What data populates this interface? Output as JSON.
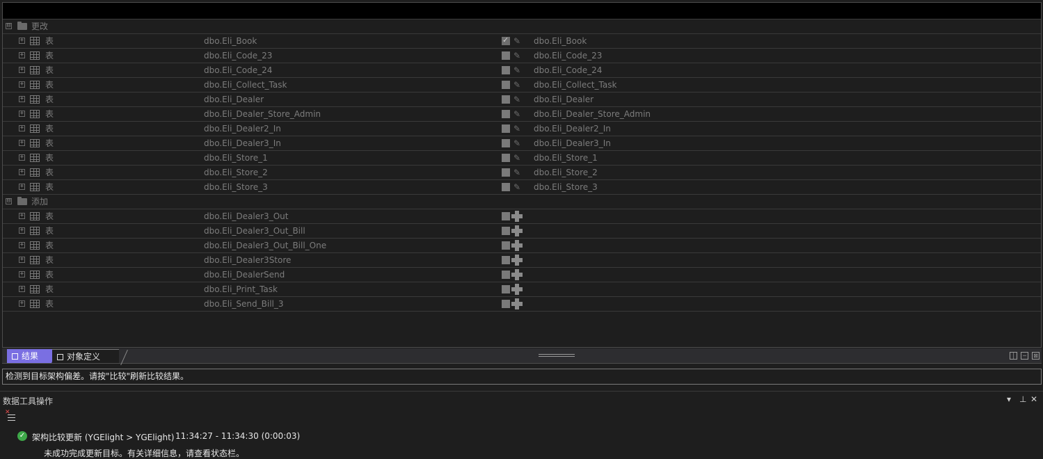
{
  "grid": {
    "groups": [
      {
        "label": "更改",
        "expander": "⊟",
        "rows": [
          {
            "type": "表",
            "source": "dbo.Eli_Book",
            "target": "dbo.Eli_Book",
            "checked": true
          },
          {
            "type": "表",
            "source": "dbo.Eli_Code_23",
            "target": "dbo.Eli_Code_23",
            "checked": false
          },
          {
            "type": "表",
            "source": "dbo.Eli_Code_24",
            "target": "dbo.Eli_Code_24",
            "checked": false
          },
          {
            "type": "表",
            "source": "dbo.Eli_Collect_Task",
            "target": "dbo.Eli_Collect_Task",
            "checked": false
          },
          {
            "type": "表",
            "source": "dbo.Eli_Dealer",
            "target": "dbo.Eli_Dealer",
            "checked": false
          },
          {
            "type": "表",
            "source": "dbo.Eli_Dealer_Store_Admin",
            "target": "dbo.Eli_Dealer_Store_Admin",
            "checked": false
          },
          {
            "type": "表",
            "source": "dbo.Eli_Dealer2_In",
            "target": "dbo.Eli_Dealer2_In",
            "checked": false
          },
          {
            "type": "表",
            "source": "dbo.Eli_Dealer3_In",
            "target": "dbo.Eli_Dealer3_In",
            "checked": false
          },
          {
            "type": "表",
            "source": "dbo.Eli_Store_1",
            "target": "dbo.Eli_Store_1",
            "checked": false
          },
          {
            "type": "表",
            "source": "dbo.Eli_Store_2",
            "target": "dbo.Eli_Store_2",
            "checked": false
          },
          {
            "type": "表",
            "source": "dbo.Eli_Store_3",
            "target": "dbo.Eli_Store_3",
            "checked": false
          }
        ]
      },
      {
        "label": "添加",
        "expander": "⊟",
        "rows": [
          {
            "type": "表",
            "source": "dbo.Eli_Dealer3_Out",
            "target": "",
            "checked": false
          },
          {
            "type": "表",
            "source": "dbo.Eli_Dealer3_Out_Bill",
            "target": "",
            "checked": false
          },
          {
            "type": "表",
            "source": "dbo.Eli_Dealer3_Out_Bill_One",
            "target": "",
            "checked": false
          },
          {
            "type": "表",
            "source": "dbo.Eli_Dealer3Store",
            "target": "",
            "checked": false
          },
          {
            "type": "表",
            "source": "dbo.Eli_DealerSend",
            "target": "",
            "checked": false
          },
          {
            "type": "表",
            "source": "dbo.Eli_Print_Task",
            "target": "",
            "checked": false
          },
          {
            "type": "表",
            "source": "dbo.Eli_Send_Bill_3",
            "target": "",
            "checked": false
          }
        ]
      }
    ],
    "row_expander": "+",
    "icons": {
      "group": "folder-icon",
      "row": "table-icon",
      "change_action": "pencil-icon",
      "add_action": "plus-icon"
    }
  },
  "tabs": {
    "results": "结果",
    "object_definition": "对象定义"
  },
  "status_message": "检测到目标架构偏差。请按\"比较\"刷新比较结果。",
  "ops": {
    "title": "数据工具操作",
    "dropdown_glyph": "▾",
    "pin_glyph": "⊥",
    "close_glyph": "✕",
    "operation": {
      "title": "架构比较更新 (YGElight > YGElight)",
      "time": "11:34:27 - 11:34:30 (0:00:03)",
      "detail": "未成功完成更新目标。有关详细信息，请查看状态栏。",
      "status_icon": "success-check-icon"
    }
  },
  "colors": {
    "accent_tab": "#7a6fe2",
    "success": "#3ea849",
    "background": "#1e1e1e"
  }
}
